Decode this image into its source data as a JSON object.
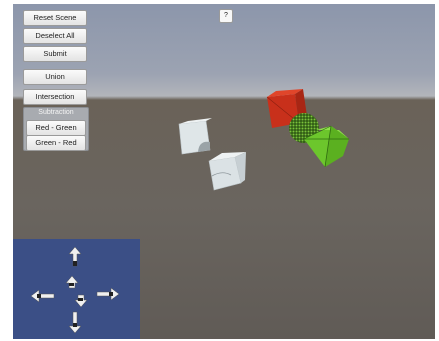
{
  "toolbar": {
    "reset_scene": "Reset Scene",
    "deselect_all": "Deselect All",
    "submit": "Submit",
    "union": "Union",
    "intersection": "Intersection",
    "subtraction": {
      "title": "Subtraction",
      "red_green": "Red - Green",
      "green_red": "Green - Red"
    }
  },
  "help_label": "?",
  "colors": {
    "red_cube": "#d2321c",
    "green_cube": "#6cc62c",
    "sphere": "#3a6e1c",
    "white_shape": "#dde4e6",
    "minimap_bg": "#3b4f86"
  },
  "icons": [
    "arrow-up-icon",
    "arrow-down-icon",
    "arrow-left-icon",
    "arrow-right-icon",
    "camera-up-icon",
    "camera-down-icon"
  ]
}
